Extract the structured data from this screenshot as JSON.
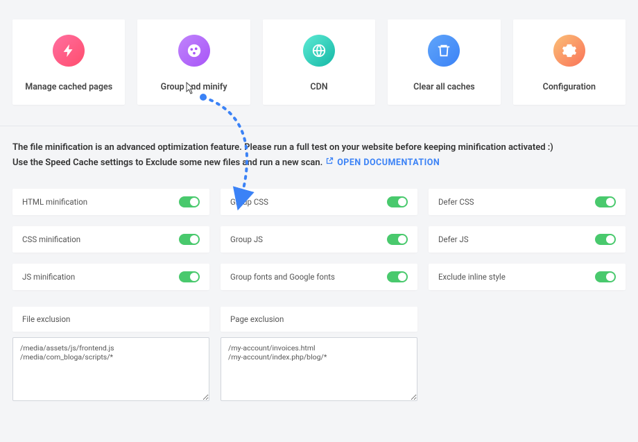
{
  "cards": [
    {
      "label": "Manage cached pages",
      "icon": "bolt",
      "gradient": "grad-pink"
    },
    {
      "label": "Group and minify",
      "icon": "palette",
      "gradient": "grad-purple"
    },
    {
      "label": "CDN",
      "icon": "globe",
      "gradient": "grad-teal"
    },
    {
      "label": "Clear all caches",
      "icon": "trash",
      "gradient": "grad-blue"
    },
    {
      "label": "Configuration",
      "icon": "gear",
      "gradient": "grad-orange"
    }
  ],
  "info": {
    "line1": "The file minification is an advanced optimization feature. Please run a full test on your website before keeping minification activated :)",
    "line2_prefix": "Use the Speed Cache settings to Exclude some new files and run a new scan. ",
    "doc_link_label": "OPEN DOCUMENTATION"
  },
  "settings": {
    "col1": [
      {
        "label": "HTML minification",
        "value": true
      },
      {
        "label": "CSS minification",
        "value": true
      },
      {
        "label": "JS minification",
        "value": true
      }
    ],
    "col2": [
      {
        "label": "Group CSS",
        "value": true
      },
      {
        "label": "Group JS",
        "value": true
      },
      {
        "label": "Group fonts and Google fonts",
        "value": true
      }
    ],
    "col3": [
      {
        "label": "Defer CSS",
        "value": true
      },
      {
        "label": "Defer JS",
        "value": true
      },
      {
        "label": "Exclude inline style",
        "value": true
      }
    ]
  },
  "exclusions": {
    "file": {
      "label": "File exclusion",
      "value": "/media/assets/js/frontend.js\n/media/com_bloga/scripts/*"
    },
    "page": {
      "label": "Page exclusion",
      "value": "/my-account/invoices.html\n/my-account/index.php/blog/*"
    }
  },
  "colors": {
    "toggle_on": "#49c96d",
    "link": "#3b82f6"
  }
}
